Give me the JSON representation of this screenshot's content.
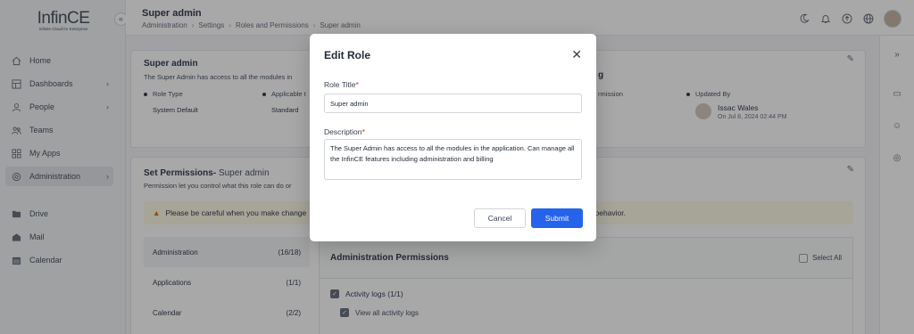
{
  "brand": {
    "name": "InfinCE",
    "tagline": "Infinite Cloud for Enterprise"
  },
  "sidebar": {
    "items": [
      {
        "label": "Home",
        "icon": "home-icon",
        "chevron": false
      },
      {
        "label": "Dashboards",
        "icon": "dashboard-icon",
        "chevron": true
      },
      {
        "label": "People",
        "icon": "user-icon",
        "chevron": true
      },
      {
        "label": "Teams",
        "icon": "team-icon",
        "chevron": false
      },
      {
        "label": "My Apps",
        "icon": "apps-icon",
        "chevron": false
      },
      {
        "label": "Administration",
        "icon": "settings-icon",
        "chevron": true,
        "active": true
      }
    ],
    "apps": [
      {
        "label": "Drive",
        "icon": "drive-icon"
      },
      {
        "label": "Mail",
        "icon": "mail-icon"
      },
      {
        "label": "Calendar",
        "icon": "calendar-icon"
      }
    ]
  },
  "header": {
    "title": "Super admin",
    "breadcrumb": [
      "Administration",
      "Settings",
      "Roles and Permissions",
      "Super admin"
    ],
    "icons": [
      "moon-icon",
      "bell-icon",
      "upload-icon",
      "globe-icon"
    ]
  },
  "role_card": {
    "title": "Super admin",
    "description": "The Super Admin has access to all the modules in",
    "role_type_label": "Role Type",
    "role_type_value": "System Default",
    "applicable_label": "Applicable t",
    "applicable_value": "Standard",
    "col3_title_fragment": "g",
    "permission_label_fragment": "rmission",
    "updated_by_label": "Updated By",
    "updated_by_name": "Issac Wales",
    "updated_by_date": "On Jul 8, 2024 02:44 PM"
  },
  "permissions_card": {
    "title": "Set Permissions-",
    "title_role": "Super admin",
    "subtitle": "Permission let you control what this role can do or",
    "warning_text": "Please be careful when you make change",
    "warning_tail": "behavior.",
    "modules": [
      {
        "name": "Administration",
        "count": "(16/18)",
        "active": true
      },
      {
        "name": "Applications",
        "count": "(1/1)"
      },
      {
        "name": "Calendar",
        "count": "(2/2)"
      }
    ],
    "detail_title": "Administration Permissions",
    "select_all": "Select All",
    "group_label": "Activity logs (1/1)",
    "group_item": "View all activity logs"
  },
  "modal": {
    "title": "Edit Role",
    "role_title_label": "Role Title",
    "role_title_value": "Super admin",
    "description_label": "Description",
    "description_value": "The Super Admin has access to all the modules in the application. Can manage all the InfinCE features including administration and billing",
    "cancel_label": "Cancel",
    "submit_label": "Submit",
    "required_mark": "*"
  },
  "colors": {
    "primary": "#2563eb",
    "required": "#dc2626",
    "overlay": "rgba(0,0,0,0.34)"
  }
}
